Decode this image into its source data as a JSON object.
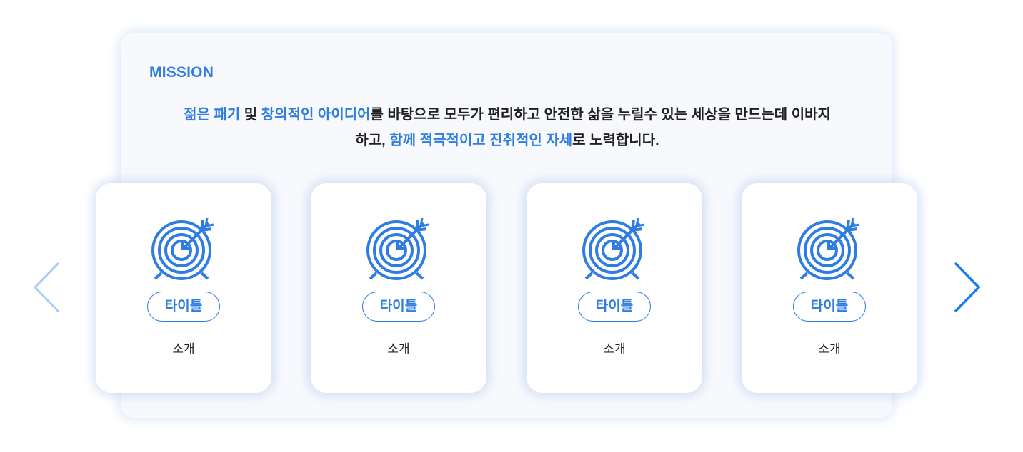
{
  "mission": {
    "label": "MISSION",
    "line1": [
      {
        "text": "젊은 패기",
        "hl": true
      },
      {
        "text": " 및 ",
        "hl": false
      },
      {
        "text": "창의적인 아이디어",
        "hl": true
      },
      {
        "text": "를 바탕으로 모두가 편리하고 안전한 삶을 누릴수 있는 세상을 만드는데 이바지",
        "hl": false
      }
    ],
    "line2": [
      {
        "text": "하고, ",
        "hl": false
      },
      {
        "text": "함께 적극적이고 진취적인 자세",
        "hl": true
      },
      {
        "text": "로 노력합니다.",
        "hl": false
      }
    ]
  },
  "cards": [
    {
      "icon": "target-icon",
      "title": "타이틀",
      "desc": "소개"
    },
    {
      "icon": "target-icon",
      "title": "타이틀",
      "desc": "소개"
    },
    {
      "icon": "target-icon",
      "title": "타이틀",
      "desc": "소개"
    },
    {
      "icon": "target-icon",
      "title": "타이틀",
      "desc": "소개"
    }
  ],
  "carousel": {
    "prev_icon": "chevron-left-icon",
    "next_icon": "chevron-right-icon"
  },
  "colors": {
    "accent": "#2f7de1",
    "arrow_prev": "#a9cdf7",
    "arrow_next": "#1a7cf0",
    "text": "#1f1f1f"
  }
}
